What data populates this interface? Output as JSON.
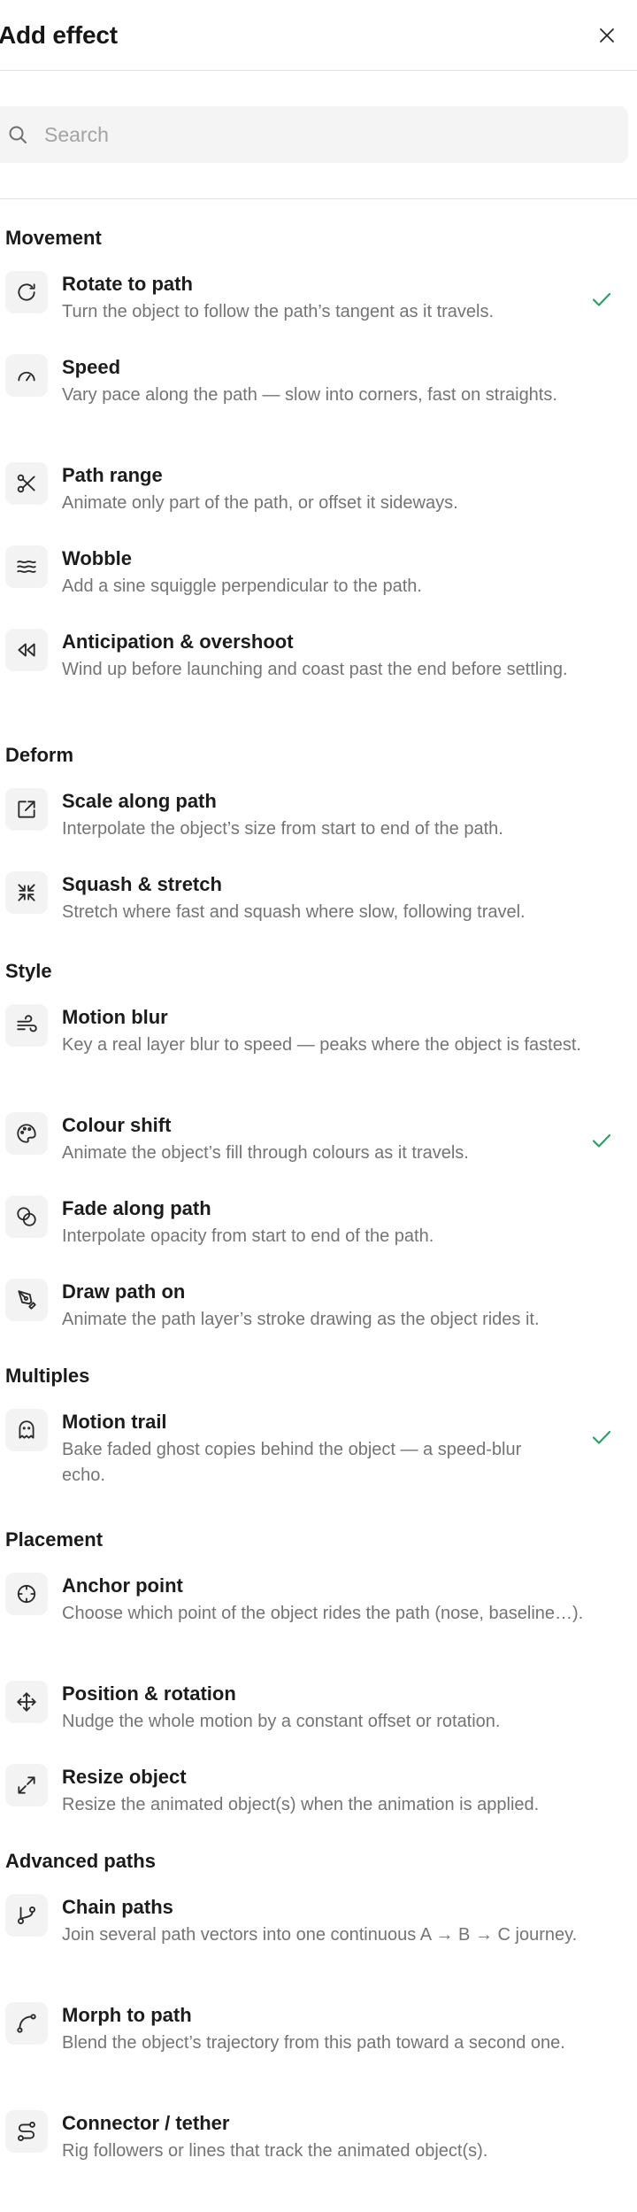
{
  "header": {
    "title": "Add effect"
  },
  "search": {
    "placeholder": "Search",
    "value": ""
  },
  "colors": {
    "check": "#2f9e6a",
    "icon_bg": "#f3f3f3"
  },
  "sections": [
    {
      "name": "Movement",
      "items": [
        {
          "title": "Rotate to path",
          "desc": "Turn the object to follow the path’s tangent as it travels.",
          "icon": "rotate-icon",
          "checked": true
        },
        {
          "title": "Speed",
          "desc": "Vary pace along the path — slow into corners, fast on straights.",
          "icon": "gauge-icon",
          "checked": false
        },
        {
          "title": "Path range",
          "desc": "Animate only part of the path, or offset it sideways.",
          "icon": "scissors-icon",
          "checked": false
        },
        {
          "title": "Wobble",
          "desc": "Add a sine squiggle perpendicular to the path.",
          "icon": "waves-icon",
          "checked": false
        },
        {
          "title": "Anticipation & overshoot",
          "desc": "Wind up before launching and coast past the end before settling.",
          "icon": "rewind-icon",
          "checked": false
        }
      ]
    },
    {
      "name": "Deform",
      "items": [
        {
          "title": "Scale along path",
          "desc": "Interpolate the object’s size from start to end of the path.",
          "icon": "scale-icon",
          "checked": false
        },
        {
          "title": "Squash & stretch",
          "desc": "Stretch where fast and squash where slow, following travel.",
          "icon": "shrink-icon",
          "checked": false
        }
      ]
    },
    {
      "name": "Style",
      "items": [
        {
          "title": "Motion blur",
          "desc": "Key a real layer blur to speed — peaks where the object is fastest.",
          "icon": "wind-icon",
          "checked": false
        },
        {
          "title": "Colour shift",
          "desc": "Animate the object’s fill through colours as it travels.",
          "icon": "palette-icon",
          "checked": true
        },
        {
          "title": "Fade along path",
          "desc": "Interpolate opacity from start to end of the path.",
          "icon": "blend-icon",
          "checked": false
        },
        {
          "title": "Draw path on",
          "desc": "Animate the path layer’s stroke drawing as the object rides it.",
          "icon": "pen-tool-icon",
          "checked": false
        }
      ]
    },
    {
      "name": "Multiples",
      "items": [
        {
          "title": "Motion trail",
          "desc": "Bake faded ghost copies behind the object — a speed-blur echo.",
          "icon": "ghost-icon",
          "checked": true
        }
      ]
    },
    {
      "name": "Placement",
      "items": [
        {
          "title": "Anchor point",
          "desc": "Choose which point of the object rides the path (nose, baseline…).",
          "icon": "crosshair-icon",
          "checked": false
        },
        {
          "title": "Position & rotation",
          "desc": "Nudge the whole motion by a constant offset or rotation.",
          "icon": "move-icon",
          "checked": false
        },
        {
          "title": "Resize object",
          "desc": "Resize the animated object(s) when the animation is applied.",
          "icon": "expand-icon",
          "checked": false
        }
      ]
    },
    {
      "name": "Advanced paths",
      "items": [
        {
          "title": "Chain paths",
          "desc": "Join several path vectors into one continuous A → B → C journey.",
          "icon": "git-branch-icon",
          "checked": false
        },
        {
          "title": "Morph to path",
          "desc": "Blend the object’s trajectory from this path toward a second one.",
          "icon": "spline-icon",
          "checked": false
        },
        {
          "title": "Connector / tether",
          "desc": "Rig followers or lines that track the animated object(s).",
          "icon": "route-icon",
          "checked": false
        }
      ]
    }
  ]
}
